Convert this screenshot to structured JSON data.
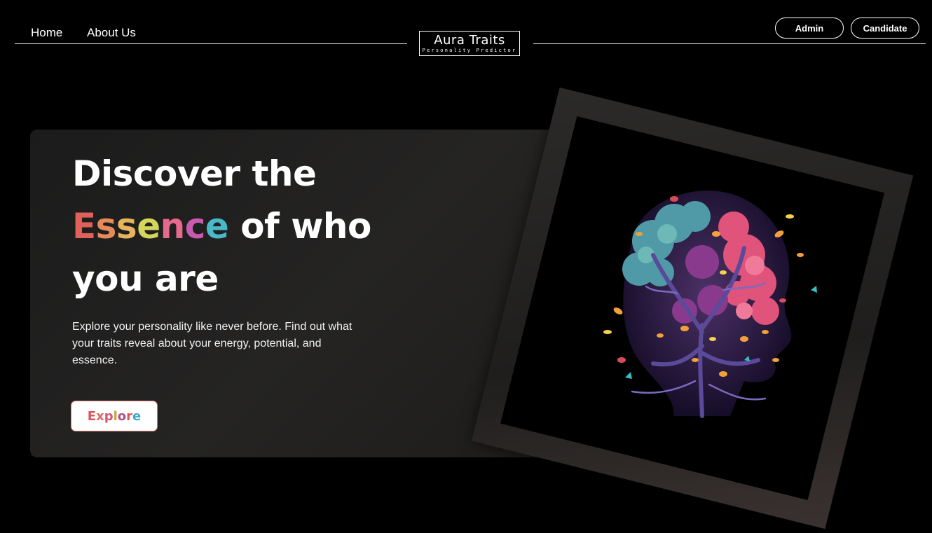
{
  "nav": {
    "links": [
      "Home",
      "About Us"
    ],
    "logo": {
      "title": "Aura Traits",
      "subtitle": "Personality Predictor"
    },
    "buttons": {
      "admin": "Admin",
      "candidate": "Candidate"
    }
  },
  "hero": {
    "line1": "Discover the",
    "essence_letters": [
      "E",
      "s",
      "s",
      "e",
      "n",
      "c",
      "e"
    ],
    "essence_colors": [
      "#e0605a",
      "#e58a5a",
      "#e7b35c",
      "#d3d65a",
      "#e56a8c",
      "#c85bb0",
      "#49b8c8"
    ],
    "line2_rest": " of who",
    "line3": "you are",
    "description": "Explore your personality like never before. Find out what your traits reveal about your energy, potential, and essence.",
    "explore_letters": [
      "E",
      "x",
      "p",
      "l",
      "o",
      "r",
      "e"
    ],
    "explore_colors": [
      "#d8545e",
      "#e06a63",
      "#d9576e",
      "#c9a13a",
      "#b14f86",
      "#d75a5a",
      "#3fa7c7"
    ]
  },
  "image": {
    "icon": "brain-tree-icon"
  },
  "colors": {
    "background": "#000000",
    "card": "#232221",
    "frame": "#2a2928"
  }
}
